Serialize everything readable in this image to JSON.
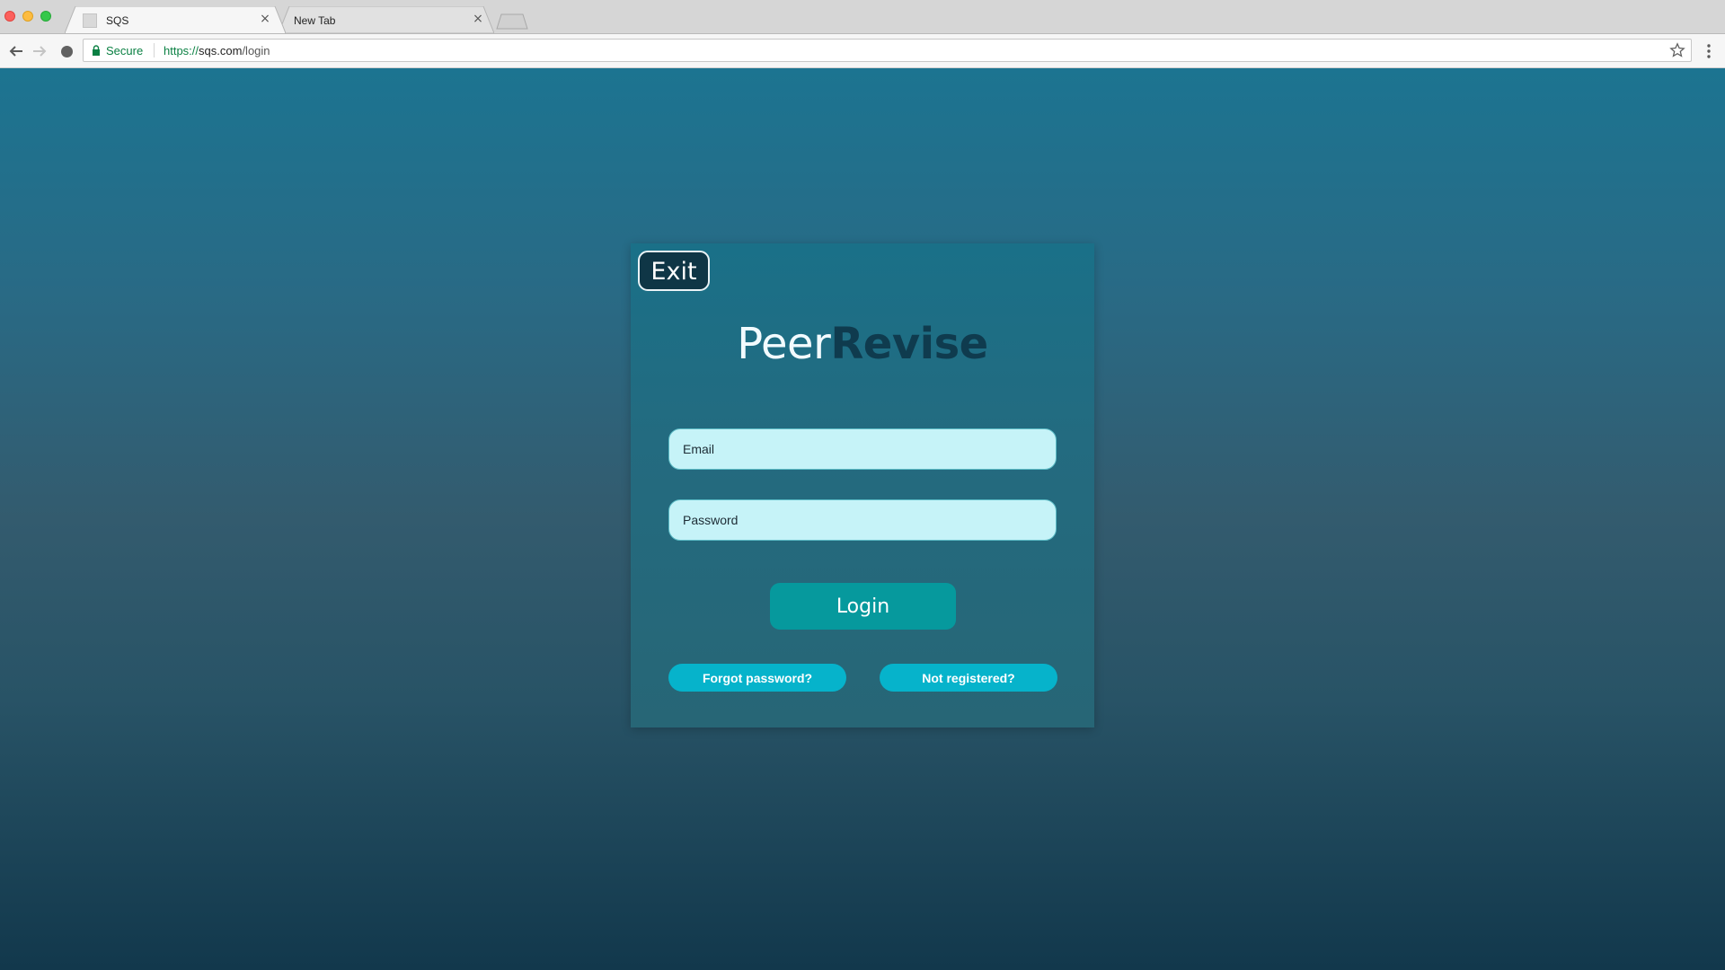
{
  "browser": {
    "tabs": [
      {
        "title": "SQS",
        "active": true
      },
      {
        "title": "New Tab",
        "active": false
      }
    ],
    "tab_close_glyph": "×",
    "security_label": "Secure",
    "url": {
      "scheme": "https://",
      "host": "sqs.com",
      "path": "/login"
    },
    "icons": [
      "back-arrow-icon",
      "forward-arrow-icon",
      "reload-icon",
      "lock-icon",
      "star-icon",
      "kebab-menu-icon",
      "favicon",
      "close-icon"
    ],
    "colors": {
      "secure_green": "#0b8043",
      "chrome_bg": "#d6d6d6",
      "toolbar_bg": "#f6f6f6"
    }
  },
  "login": {
    "exit_label": "Exit",
    "brand": {
      "part1": "Peer",
      "part2": "Revise"
    },
    "email_placeholder": "Email",
    "password_placeholder": "Password",
    "login_label": "Login",
    "forgot_label": "Forgot password?",
    "register_label": "Not registered?",
    "colors": {
      "background_top": "#1c7491",
      "background_bottom": "#12384c",
      "field_bg": "#c6f3f8",
      "login_button": "#06999d",
      "link_button": "#06b3cb",
      "exit_button": "#0f3646",
      "brand_dark": "#0f3b4e"
    }
  }
}
